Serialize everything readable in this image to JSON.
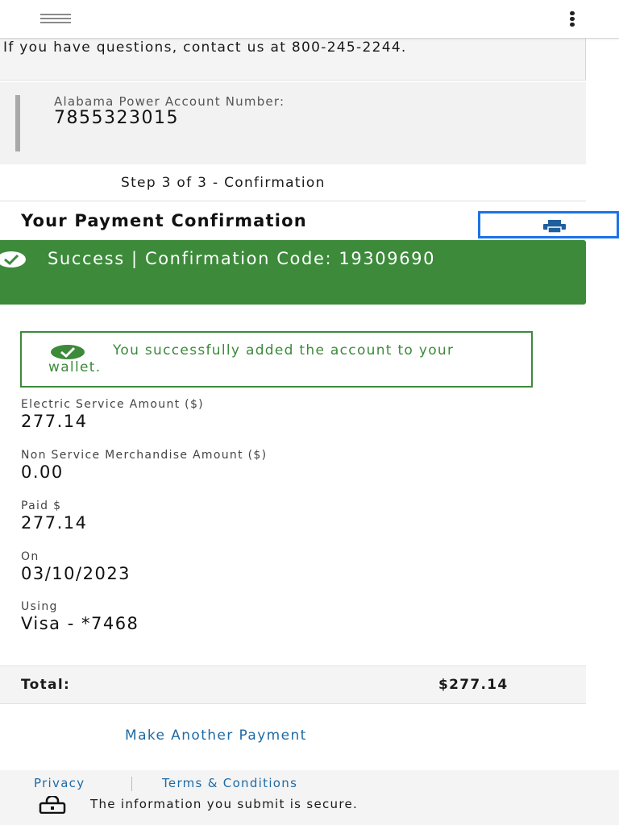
{
  "header": {
    "menu_icon": "hamburger-menu-icon",
    "more_icon": "more-vertical-icon"
  },
  "contact": {
    "text": "If you have questions, contact us at 800-245-2244."
  },
  "account": {
    "label": "Alabama Power Account Number:",
    "number": "7855323015"
  },
  "step": {
    "text": "Step 3 of 3 - Confirmation"
  },
  "confirmation": {
    "title": "Your Payment Confirmation",
    "print_icon": "print-icon"
  },
  "success": {
    "text": "Success | Confirmation Code: 19309690",
    "icon": "check-circle-icon"
  },
  "wallet": {
    "text": "You successfully added the account to your wallet.",
    "icon": "check-circle-icon"
  },
  "fields": {
    "electric_label": "Electric Service Amount ($)",
    "electric_value": "277.14",
    "merch_label": "Non Service Merchandise Amount ($)",
    "merch_value": "0.00",
    "paid_label": "Paid $",
    "paid_value": "277.14",
    "on_label": "On",
    "on_value": "03/10/2023",
    "using_label": "Using",
    "using_value": "Visa - *7468"
  },
  "total": {
    "label": "Total:",
    "value": "$277.14"
  },
  "actions": {
    "make_another_payment": "Make Another Payment"
  },
  "footer": {
    "privacy": "Privacy",
    "terms": "Terms & Conditions",
    "secure_text": "The information you submit is secure.",
    "lock_icon": "lock-icon"
  },
  "colors": {
    "success_green": "#3c8a3a",
    "link_blue": "#1f6aa5",
    "focus_blue": "#1a73e8",
    "panel_gray": "#f2f2f2"
  }
}
